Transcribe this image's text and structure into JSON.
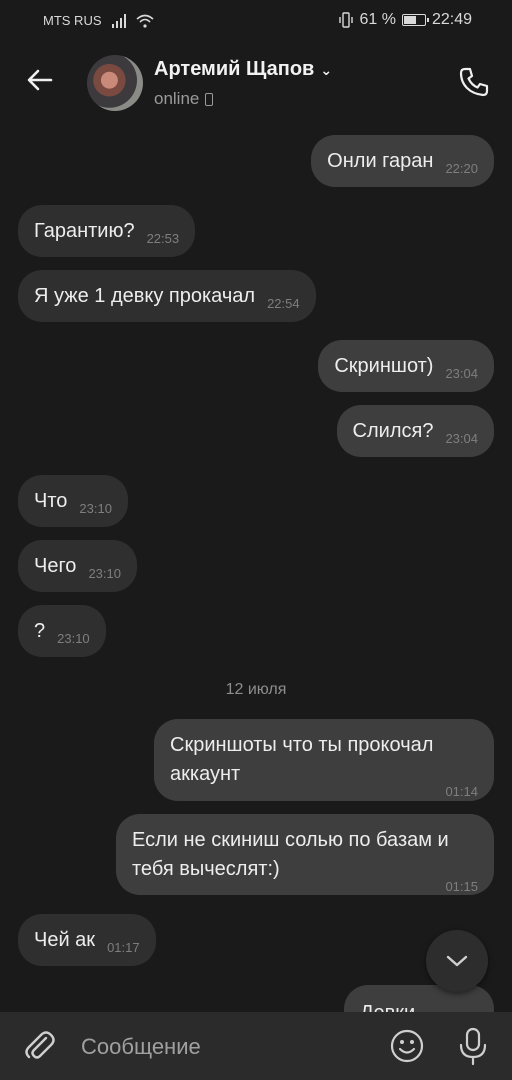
{
  "status_bar": {
    "carrier": "MTS RUS",
    "battery_text": "61 %",
    "battery_level": 0.61,
    "time": "22:49"
  },
  "header": {
    "name": "Артемий Щапов",
    "status": "online"
  },
  "messages": [
    {
      "direction": "out",
      "text": "Онли гаран",
      "time": "22:20"
    },
    {
      "direction": "in",
      "text": "Гарантию?",
      "time": "22:53"
    },
    {
      "direction": "in",
      "text": "Я уже 1 девку прокачал",
      "time": "22:54"
    },
    {
      "direction": "out",
      "text": "Скриншот)",
      "time": "23:04"
    },
    {
      "direction": "out",
      "text": "Слился?",
      "time": "23:04"
    },
    {
      "direction": "in",
      "text": "Что",
      "time": "23:10"
    },
    {
      "direction": "in",
      "text": "Чего",
      "time": "23:10"
    },
    {
      "direction": "in",
      "text": "?",
      "time": "23:10"
    },
    {
      "direction": "out",
      "text": "Скриншоты что ты прокочал аккаунт",
      "time": "01:14"
    },
    {
      "direction": "out",
      "text": "Если не скиниш солью по базам и тебя вычеслят:)",
      "time": "01:15"
    },
    {
      "direction": "in",
      "text": "Чей ак",
      "time": "01:17"
    },
    {
      "direction": "out",
      "text": "Девки",
      "time": ""
    }
  ],
  "date_separator": "12 июля",
  "composer": {
    "placeholder": "Сообщение"
  }
}
